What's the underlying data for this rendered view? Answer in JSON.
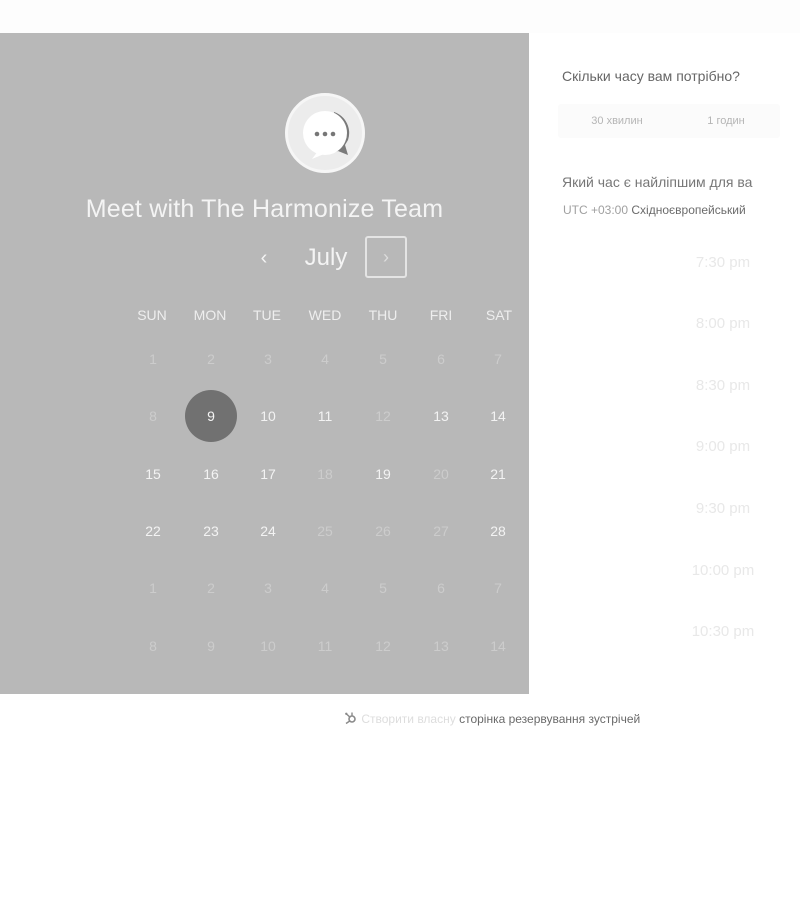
{
  "header": {
    "title": "Meet with The Harmonize Team",
    "logo_icon": "chat-bubble-icon"
  },
  "calendar": {
    "month": "July",
    "prev_icon": "‹",
    "next_icon": "›",
    "weekdays": [
      "SUN",
      "MON",
      "TUE",
      "WED",
      "THU",
      "FRI",
      "SAT"
    ],
    "weeks": [
      [
        "1",
        "2",
        "3",
        "4",
        "5",
        "6",
        "7"
      ],
      [
        "8",
        "9",
        "10",
        "11",
        "12",
        "13",
        "14"
      ],
      [
        "15",
        "16",
        "17",
        "18",
        "19",
        "20",
        "21"
      ],
      [
        "22",
        "23",
        "24",
        "25",
        "26",
        "27",
        "28"
      ],
      [
        "1",
        "2",
        "3",
        "4",
        "5",
        "6",
        "7"
      ],
      [
        "8",
        "9",
        "10",
        "11",
        "12",
        "13",
        "14"
      ]
    ],
    "selected": "9"
  },
  "duration": {
    "question": "Скільки часу вам потрібно?",
    "options": [
      "30 хвилин",
      "1 годин"
    ]
  },
  "time": {
    "question": "Який час є найліпшим для ва",
    "timezone_offset": "UTC +03:00",
    "timezone_name": "Східноєвропейський",
    "slots": [
      "7:30 pm",
      "8:00 pm",
      "8:30 pm",
      "9:00 pm",
      "9:30 pm",
      "10:00 pm",
      "10:30 pm"
    ]
  },
  "footer": {
    "icon": "hubspot-sprocket-icon",
    "text_light": "Створити власну",
    "text_dark": "сторінка резервування зустрічей"
  },
  "colors": {
    "left_panel": "#b8b8b8",
    "selected_day": "#717171"
  }
}
